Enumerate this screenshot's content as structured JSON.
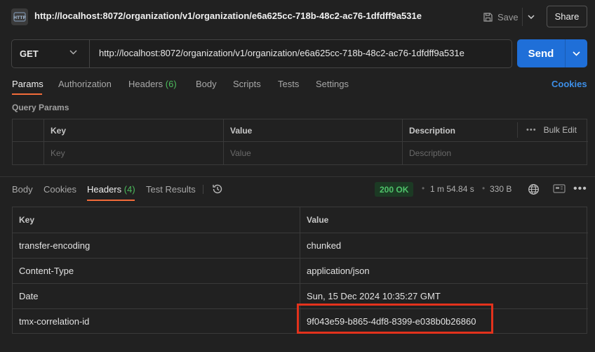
{
  "header": {
    "title_url": "http://localhost:8072/organization/v1/organization/e6a625cc-718b-48c2-ac76-1dfdff9a531e",
    "save_label": "Save",
    "share_label": "Share"
  },
  "request": {
    "method": "GET",
    "url": "http://localhost:8072/organization/v1/organization/e6a625cc-718b-48c2-ac76-1dfdff9a531e",
    "send_label": "Send"
  },
  "request_tabs": {
    "params": "Params",
    "authorization": "Authorization",
    "headers": "Headers",
    "headers_count": "(6)",
    "body": "Body",
    "scripts": "Scripts",
    "tests": "Tests",
    "settings": "Settings",
    "cookies": "Cookies"
  },
  "query_params": {
    "title": "Query Params",
    "columns": [
      "Key",
      "Value",
      "Description"
    ],
    "bulk_edit": "Bulk Edit",
    "placeholders": [
      "Key",
      "Value",
      "Description"
    ]
  },
  "response_tabs": {
    "body": "Body",
    "cookies": "Cookies",
    "headers": "Headers",
    "headers_count": "(4)",
    "test_results": "Test Results"
  },
  "response_meta": {
    "status": "200 OK",
    "time": "1 m 54.84 s",
    "size": "330 B"
  },
  "response_headers": {
    "columns": [
      "Key",
      "Value"
    ],
    "rows": [
      {
        "key": "transfer-encoding",
        "value": "chunked"
      },
      {
        "key": "Content-Type",
        "value": "application/json"
      },
      {
        "key": "Date",
        "value": "Sun, 15 Dec 2024 10:35:27 GMT"
      },
      {
        "key": "tmx-correlation-id",
        "value": "9f043e59-b865-4df8-8399-e038b0b26860"
      }
    ]
  },
  "colors": {
    "accent": "#f26b3a",
    "send": "#1f6fd8",
    "success": "#4fc36a",
    "highlight": "#e3321c"
  }
}
